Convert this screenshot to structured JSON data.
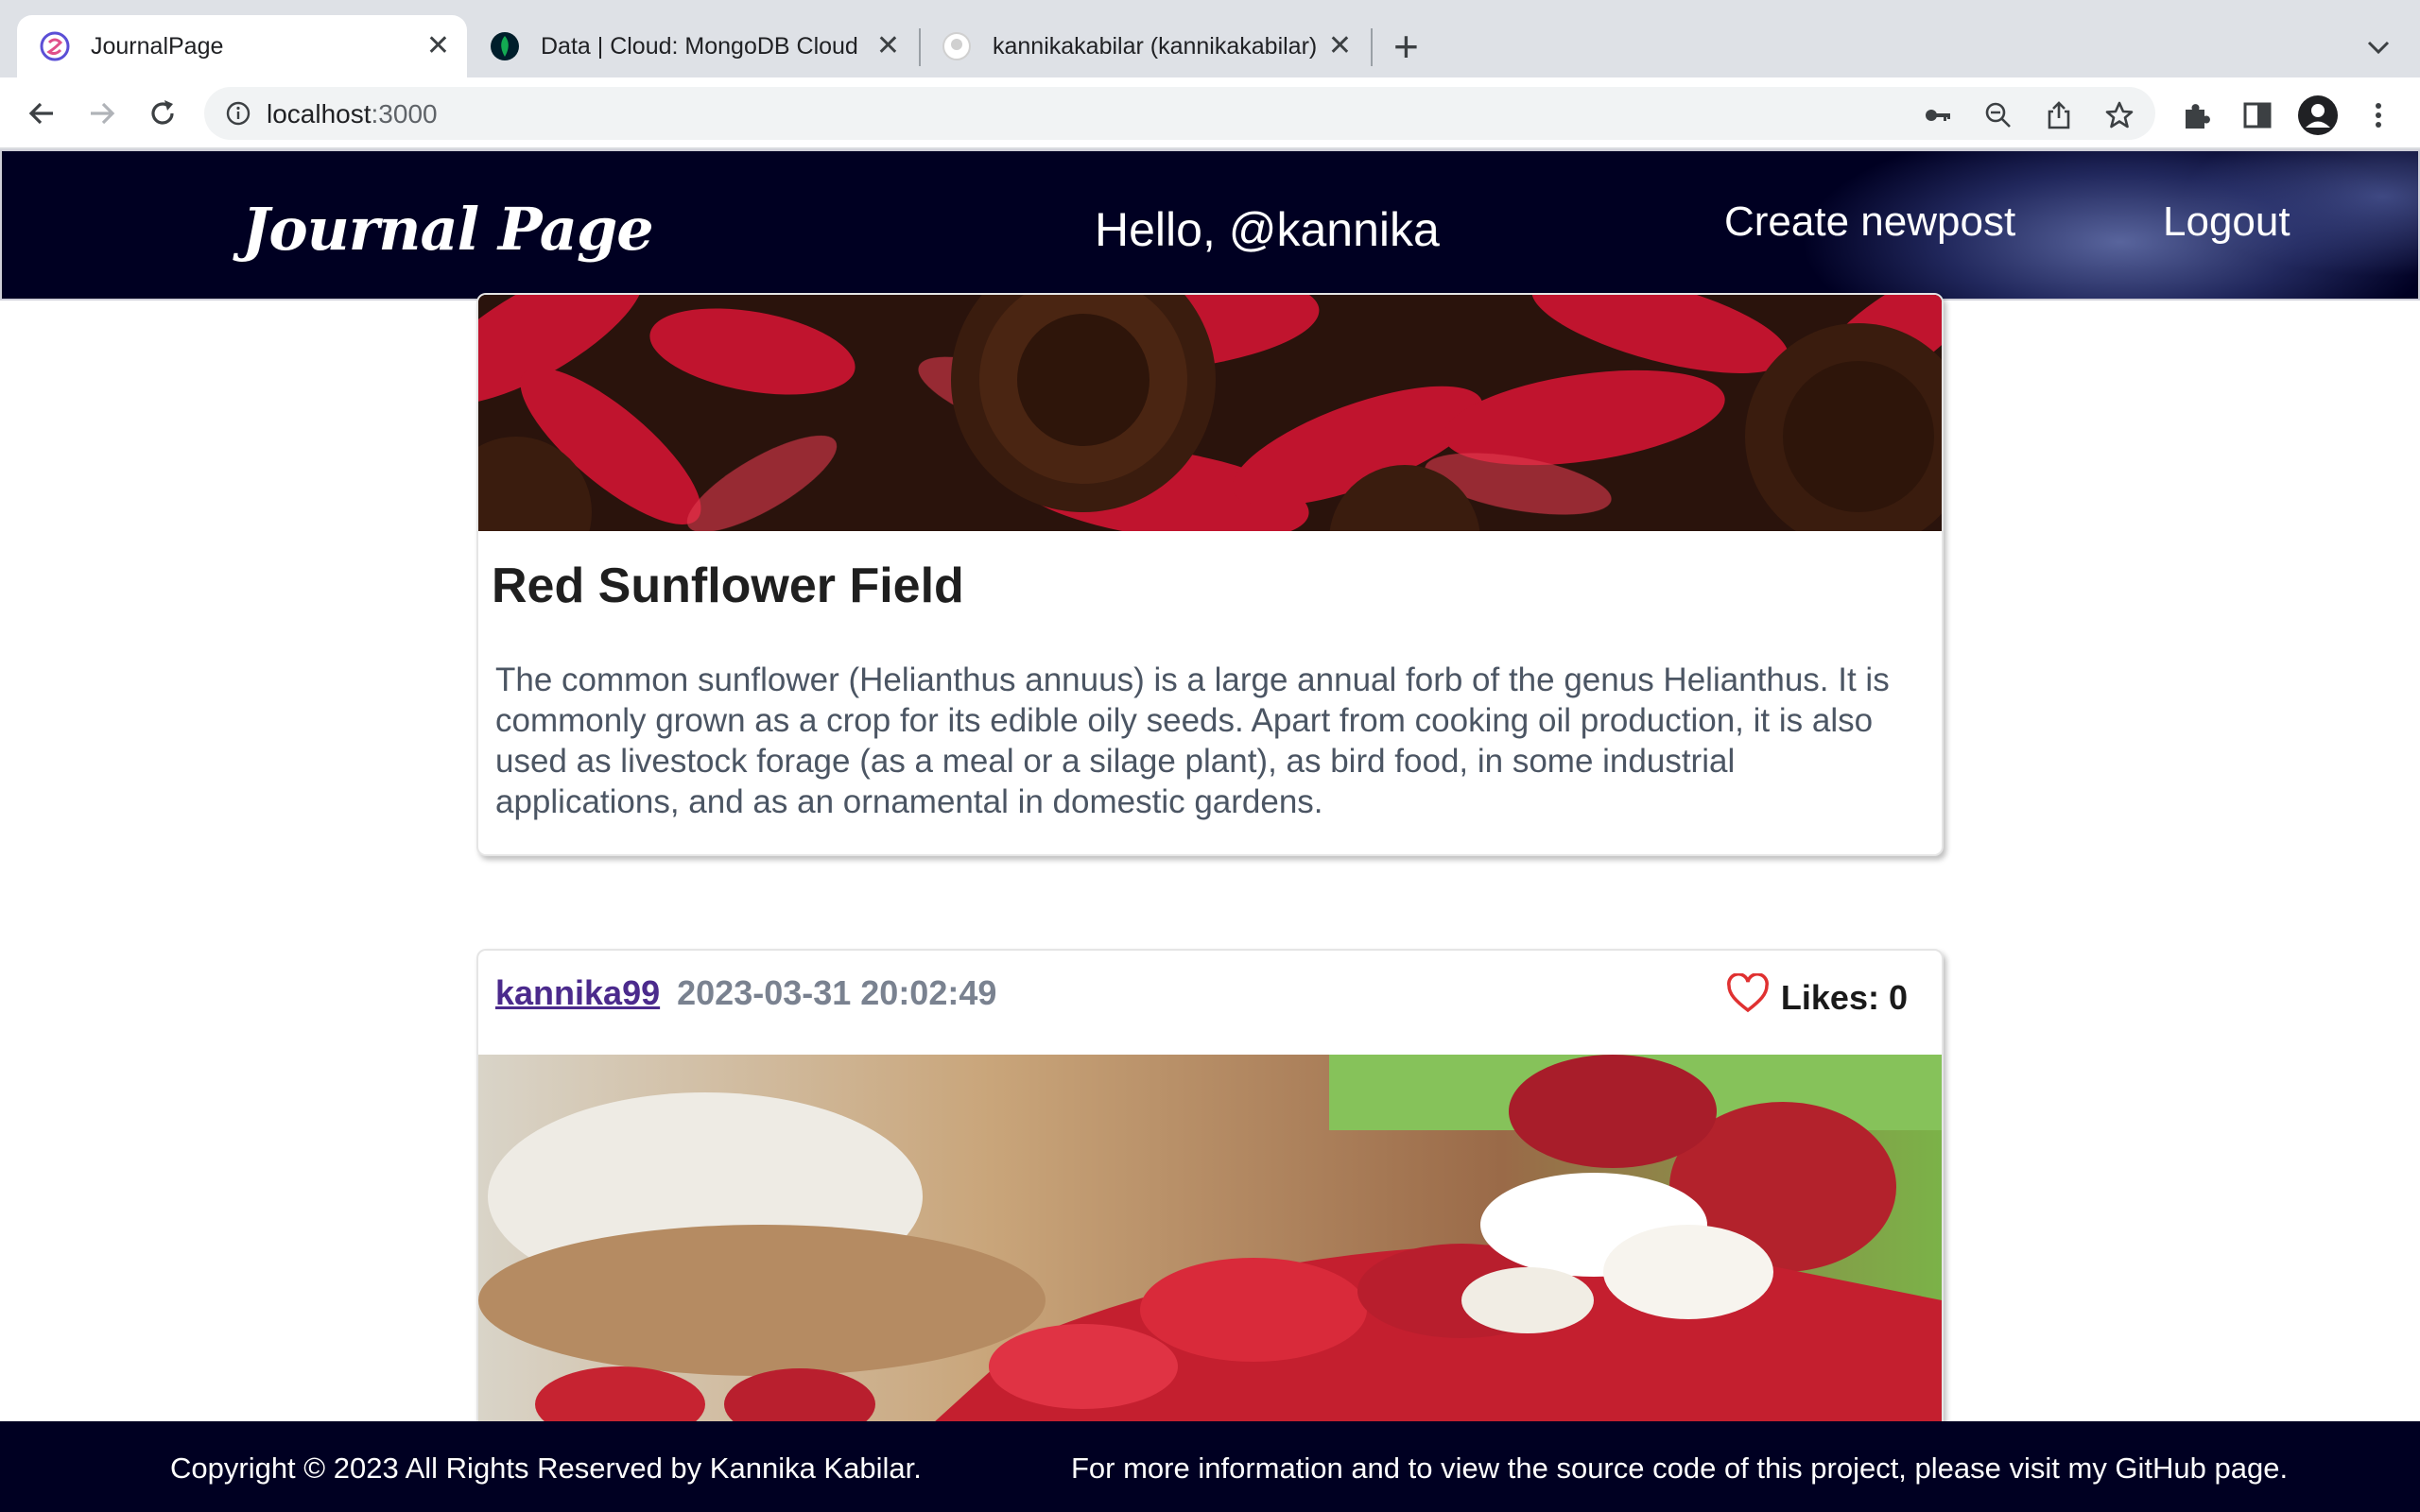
{
  "browser": {
    "tabs": [
      {
        "title": "JournalPage",
        "active": true,
        "favicon_color": "#5b4fd6"
      },
      {
        "title": "Data | Cloud: MongoDB Cloud",
        "active": false,
        "favicon_color": "#00684a"
      },
      {
        "title": "kannikakabilar (kannikakabilar)",
        "active": false,
        "favicon_color": "#ffffff"
      }
    ],
    "close_glyph": "✕",
    "new_tab_glyph": "+",
    "url_host": "localhost",
    "url_port": ":3000"
  },
  "header": {
    "logo": "Journal Page",
    "greeting": "Hello, @kannika",
    "nav": {
      "create": "Create newpost",
      "logout": "Logout"
    }
  },
  "posts": [
    {
      "title": "Red Sunflower Field",
      "body": "The common sunflower (Helianthus annuus) is a large annual forb of the genus Helianthus. It is commonly grown as a crop for its edible oily seeds. Apart from cooking oil production, it is also used as livestock forage (as a meal or a silage plant), as bird food, in some industrial applications, and as an ornamental in domestic gardens."
    },
    {
      "author": "kannika99",
      "timestamp": "2023-03-31 20:02:49",
      "likes_label": "Likes: 0"
    }
  ],
  "footer": {
    "copyright": "Copyright © 2023 All Rights Reserved by Kannika Kabilar.",
    "info": "For more information and to view the source code of this project, please visit my GitHub page."
  },
  "colors": {
    "header_bg": "#000022",
    "author_link": "#4b2a8c",
    "heart": "#e03131"
  }
}
